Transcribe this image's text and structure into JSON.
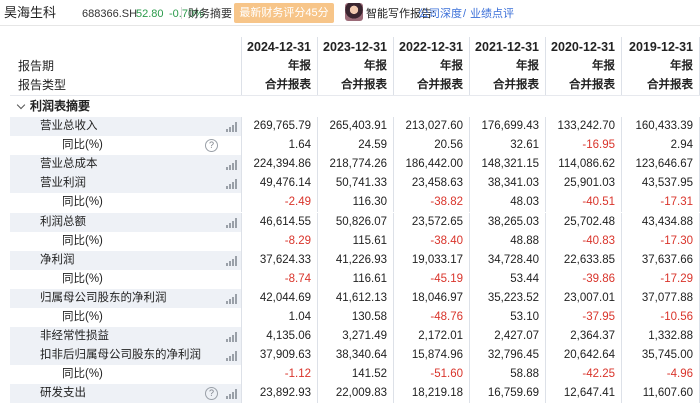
{
  "header": {
    "stock_name": "昊海生科",
    "stock_code": "688366.SH",
    "price": "52.80",
    "change": "-0.70%",
    "fin_summary": "财务摘要",
    "score_button": "最新财务评分45分",
    "ai_label": "智能写作报告:",
    "ai_link1": "公司深度",
    "ai_slash": "/",
    "ai_link2": "业绩点评"
  },
  "colors": {
    "negative": "#d9342b",
    "positive_change": "#2a9a4a",
    "score_button": "#f7c589",
    "link": "#3a6fd8"
  },
  "table": {
    "period_label": "报告期",
    "type_label": "报告类型",
    "dates": [
      "2024-12-31",
      "2023-12-31",
      "2022-12-31",
      "2021-12-31",
      "2020-12-31",
      "2019-12-31"
    ],
    "report_kind": [
      "年报",
      "年报",
      "年报",
      "年报",
      "年报",
      "年报"
    ],
    "report_type": [
      "合并报表",
      "合并报表",
      "合并报表",
      "合并报表",
      "合并报表",
      "合并报表"
    ],
    "section_title": "利润表摘要",
    "rows": [
      {
        "label": "营业总收入",
        "values": [
          "269,765.79",
          "265,403.91",
          "213,027.60",
          "176,699.43",
          "133,242.70",
          "160,433.39"
        ],
        "bars": true
      },
      {
        "label": "同比(%)",
        "values": [
          "1.64",
          "24.59",
          "20.56",
          "32.61",
          "-16.95",
          "2.94"
        ],
        "help": true
      },
      {
        "label": "营业总成本",
        "values": [
          "224,394.86",
          "218,774.26",
          "186,442.00",
          "148,321.15",
          "114,086.62",
          "123,646.67"
        ],
        "bars": true
      },
      {
        "label": "营业利润",
        "values": [
          "49,476.14",
          "50,741.33",
          "23,458.63",
          "38,341.03",
          "25,901.03",
          "43,537.95"
        ],
        "bars": true
      },
      {
        "label": "同比(%)",
        "values": [
          "-2.49",
          "116.30",
          "-38.82",
          "48.03",
          "-40.51",
          "-17.31"
        ]
      },
      {
        "label": "利润总额",
        "values": [
          "46,614.55",
          "50,826.07",
          "23,572.65",
          "38,265.03",
          "25,702.48",
          "43,434.88"
        ],
        "bars": true
      },
      {
        "label": "同比(%)",
        "values": [
          "-8.29",
          "115.61",
          "-38.40",
          "48.88",
          "-40.83",
          "-17.30"
        ]
      },
      {
        "label": "净利润",
        "values": [
          "37,624.33",
          "41,226.93",
          "19,033.17",
          "34,728.40",
          "22,633.85",
          "37,637.66"
        ],
        "bars": true
      },
      {
        "label": "同比(%)",
        "values": [
          "-8.74",
          "116.61",
          "-45.19",
          "53.44",
          "-39.86",
          "-17.29"
        ]
      },
      {
        "label": "归属母公司股东的净利润",
        "values": [
          "42,044.69",
          "41,612.13",
          "18,046.97",
          "35,223.52",
          "23,007.01",
          "37,077.88"
        ],
        "bars": true
      },
      {
        "label": "同比(%)",
        "values": [
          "1.04",
          "130.58",
          "-48.76",
          "53.10",
          "-37.95",
          "-10.56"
        ]
      },
      {
        "label": "非经常性损益",
        "values": [
          "4,135.06",
          "3,271.49",
          "2,172.01",
          "2,427.07",
          "2,364.37",
          "1,332.88"
        ],
        "bars": true
      },
      {
        "label": "扣非后归属母公司股东的净利润",
        "values": [
          "37,909.63",
          "38,340.64",
          "15,874.96",
          "32,796.45",
          "20,642.64",
          "35,745.00"
        ],
        "bars": true
      },
      {
        "label": "同比(%)",
        "values": [
          "-1.12",
          "141.52",
          "-51.60",
          "58.88",
          "-42.25",
          "-4.96"
        ]
      },
      {
        "label": "研发支出",
        "values": [
          "23,892.93",
          "22,009.83",
          "18,219.18",
          "16,759.69",
          "12,647.41",
          "11,607.60"
        ],
        "bars": true,
        "help": true
      }
    ]
  }
}
